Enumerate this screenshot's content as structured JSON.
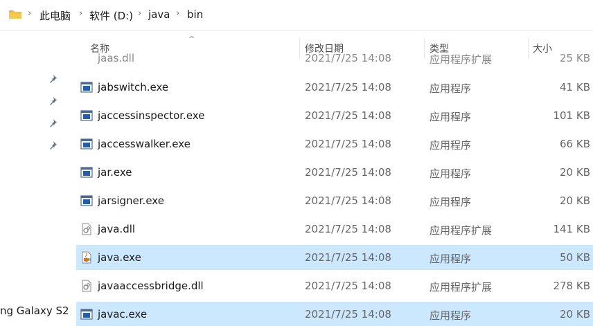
{
  "breadcrumb": {
    "items": [
      "此电脑",
      "软件 (D:)",
      "java",
      "bin"
    ],
    "separator": "›"
  },
  "nav": {
    "partial_label": "ng Galaxy S2"
  },
  "columns": {
    "name": "名称",
    "date": "修改日期",
    "type": "类型",
    "size": "大小",
    "sort_indicator": "^"
  },
  "partial_row": {
    "name": "jaas.dll",
    "date": "2021/7/25 14:08",
    "type": "应用程序扩展",
    "size": "25 KB"
  },
  "files": [
    {
      "name": "jabswitch.exe",
      "date": "2021/7/25 14:08",
      "type": "应用程序",
      "size": "41 KB",
      "icon": "exe-icon"
    },
    {
      "name": "jaccessinspector.exe",
      "date": "2021/7/25 14:08",
      "type": "应用程序",
      "size": "101 KB",
      "icon": "exe-icon"
    },
    {
      "name": "jaccesswalker.exe",
      "date": "2021/7/25 14:08",
      "type": "应用程序",
      "size": "66 KB",
      "icon": "exe-icon"
    },
    {
      "name": "jar.exe",
      "date": "2021/7/25 14:08",
      "type": "应用程序",
      "size": "20 KB",
      "icon": "exe-icon"
    },
    {
      "name": "jarsigner.exe",
      "date": "2021/7/25 14:08",
      "type": "应用程序",
      "size": "20 KB",
      "icon": "exe-icon"
    },
    {
      "name": "java.dll",
      "date": "2021/7/25 14:08",
      "type": "应用程序扩展",
      "size": "141 KB",
      "icon": "dll-icon"
    },
    {
      "name": "java.exe",
      "date": "2021/7/25 14:08",
      "type": "应用程序",
      "size": "50 KB",
      "icon": "java-cup-icon",
      "selected": true
    },
    {
      "name": "javaaccessbridge.dll",
      "date": "2021/7/25 14:08",
      "type": "应用程序扩展",
      "size": "278 KB",
      "icon": "dll-icon"
    },
    {
      "name": "javac.exe",
      "date": "2021/7/25 14:08",
      "type": "应用程序",
      "size": "20 KB",
      "icon": "exe-icon",
      "selected": true
    }
  ],
  "colors": {
    "selection": "#cce8ff",
    "folder": "#e8b74a",
    "exe_blue": "#1e5fb4"
  }
}
